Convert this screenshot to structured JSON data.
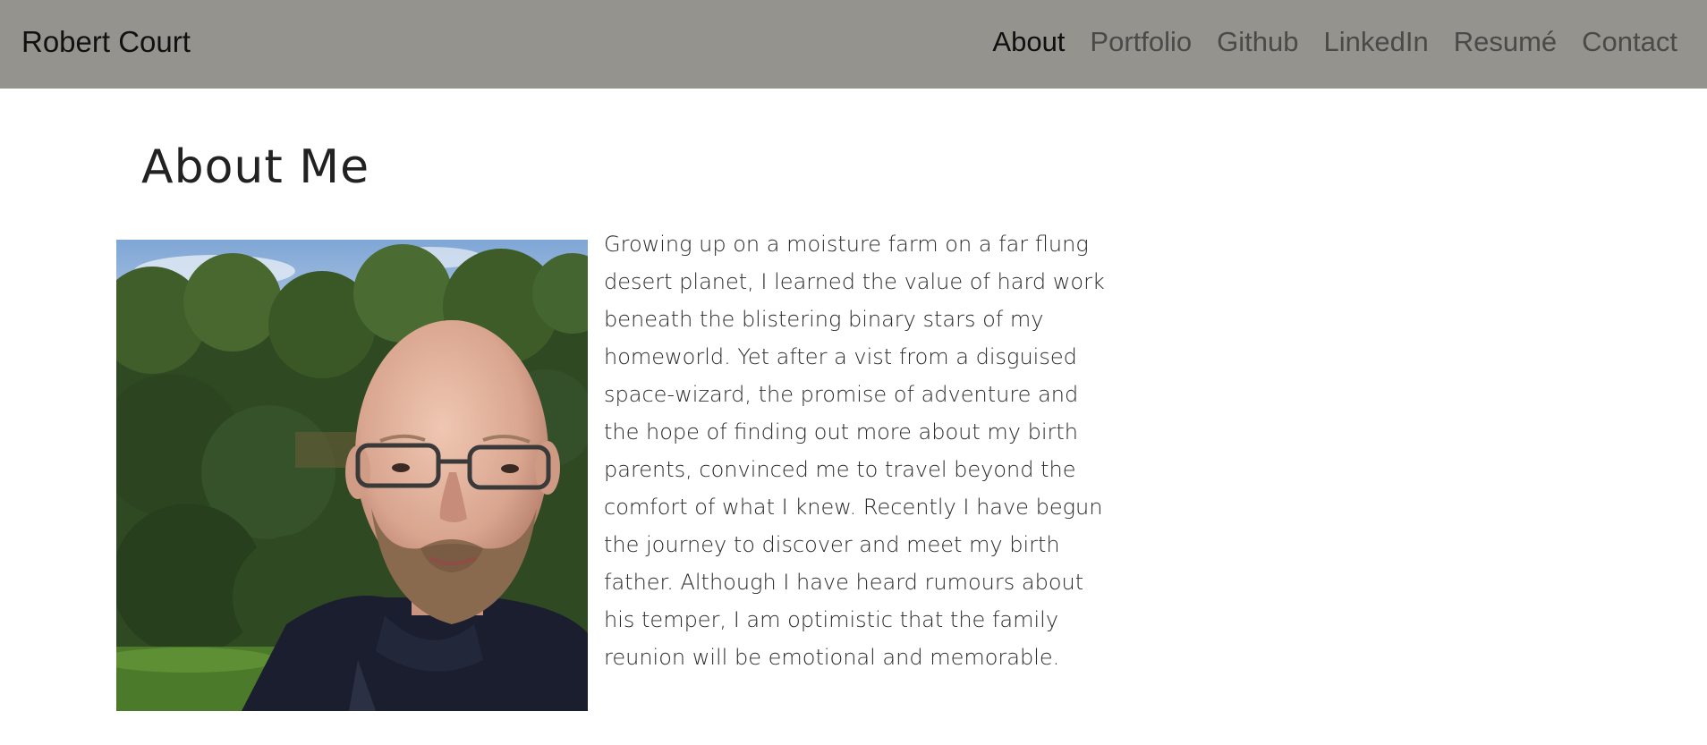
{
  "navbar": {
    "brand": "Robert Court",
    "links": [
      {
        "label": "About",
        "active": true
      },
      {
        "label": "Portfolio",
        "active": false
      },
      {
        "label": "Github",
        "active": false
      },
      {
        "label": "LinkedIn",
        "active": false
      },
      {
        "label": "Resumé",
        "active": false
      },
      {
        "label": "Contact",
        "active": false
      }
    ]
  },
  "about": {
    "title": "About Me",
    "bio": "Growing up on a moisture farm on a far flung desert planet, I learned the value of hard work beneath the blistering binary stars of my homeworld. Yet after a vist from a disguised space-wizard, the promise of adventure and the hope of finding out more about my birth parents, convinced me to travel beyond the comfort of what I knew. Recently I have begun the journey to discover and meet my birth father. Although I have heard rumours about his temper, I am optimistic that the family reunion will be emotional and memorable."
  },
  "colors": {
    "navbar_bg": "#94938d",
    "active_link": "#0f0f0f",
    "inactive_link": "#4a4a48"
  }
}
